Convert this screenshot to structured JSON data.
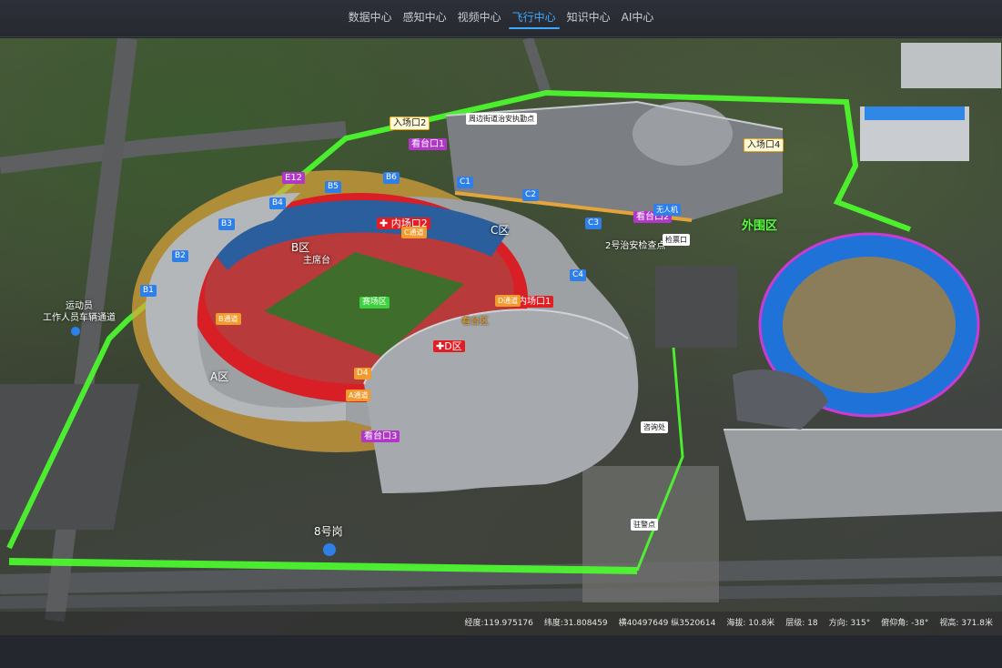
{
  "nav": {
    "tabs": [
      "数据中心",
      "感知中心",
      "视频中心",
      "飞行中心",
      "知识中心",
      "AI中心"
    ],
    "active_index": 3,
    "accent": "#3fa9ff"
  },
  "map": {
    "zone_labels": {
      "a": "A区",
      "b": "B区",
      "c": "C区",
      "d": "D区",
      "outer": "外围区",
      "main_stand": "主席台",
      "field": "赛场区",
      "stand_area": "看台区"
    },
    "gates": {
      "entry2": "入场口2",
      "entry4": "入场口4",
      "inner1": "内场口1",
      "inner2": "内场口2",
      "stand1": "看台口1",
      "stand2": "看台口2",
      "stand3": "看台口3"
    },
    "sections": [
      "B1",
      "B2",
      "B3",
      "B4",
      "B5",
      "B6",
      "C1",
      "C2",
      "C3",
      "C4",
      "D4",
      "E12"
    ],
    "passages": {
      "a": "A通道",
      "b": "B通道",
      "c": "C通道",
      "d": "D通道"
    },
    "points": {
      "surrounding": "周边街道治安执勤点",
      "police_check": "2号治安检查点",
      "drone": "无人机",
      "check_point": "检票口",
      "inquiry": "咨询处",
      "police_station": "驻警点",
      "athlete_lane": "运动员\n工作人员车辆通道",
      "post8": "8号岗"
    },
    "colors": {
      "boundary": "#4cff2e",
      "stands": "#e01f25",
      "track": "#1f73d8"
    }
  },
  "status": {
    "lng": "经度:119.975176",
    "lat": "纬度:31.808459",
    "xy": "横40497649 纵3520614",
    "alt": "海拔: 10.8米",
    "level": "层级: 18",
    "heading": "方向: 315°",
    "pitch": "俯仰角: -38°",
    "view_height": "视高: 371.8米"
  }
}
